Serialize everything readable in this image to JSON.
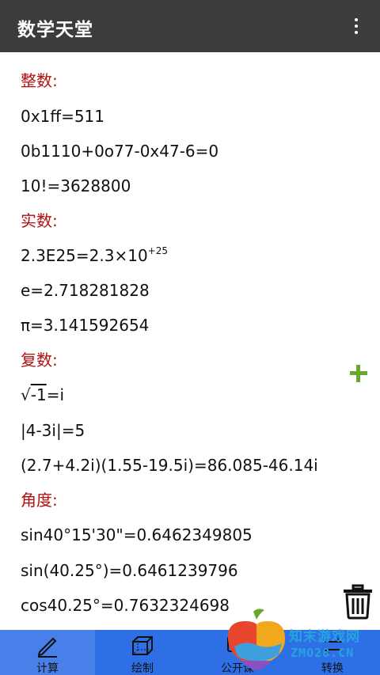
{
  "app": {
    "title": "数学天堂"
  },
  "icons": {
    "menu": "more-vert-icon",
    "add": "plus-icon",
    "delete": "trash-icon"
  },
  "colors": {
    "heading": "#b01010",
    "appbar": "#3c3c3c",
    "bottombar": "#2f6fe6",
    "plus": "#6aa82c"
  },
  "sections": {
    "integer": {
      "heading": "整数:",
      "lines": [
        "0x1ff=511",
        "0b1110+0o77-0x47-6=0",
        "10!=3628800"
      ]
    },
    "real": {
      "heading": "实数:",
      "sci_base": "2.3E25=2.3×10",
      "sci_exp": "+25",
      "lines": [
        "e=2.718281828",
        "π=3.141592654"
      ]
    },
    "complex": {
      "heading": "复数:",
      "sqrt_sign": "√",
      "sqrt_radicand": "-1",
      "sqrt_result": "=i",
      "lines": [
        "|4-3i|=5",
        "(2.7+4.2i)(1.55-19.5i)=86.085-46.14i"
      ]
    },
    "angle": {
      "heading": "角度:",
      "lines": [
        "sin40°15'30\"=0.6462349805",
        "sin(40.25°)=0.6461239796",
        "cos40.25°=0.7632324698"
      ]
    }
  },
  "tabs": [
    {
      "label": "计算",
      "icon": "pencil-icon",
      "active": true
    },
    {
      "label": "绘制",
      "icon": "cube-icon",
      "active": false
    },
    {
      "label": "公开课",
      "icon": "class-icon",
      "active": false
    },
    {
      "label": "转换",
      "icon": "convert-icon",
      "active": false
    }
  ],
  "watermark": {
    "name": "知末游戏网",
    "url": "ZMO28.CN"
  }
}
